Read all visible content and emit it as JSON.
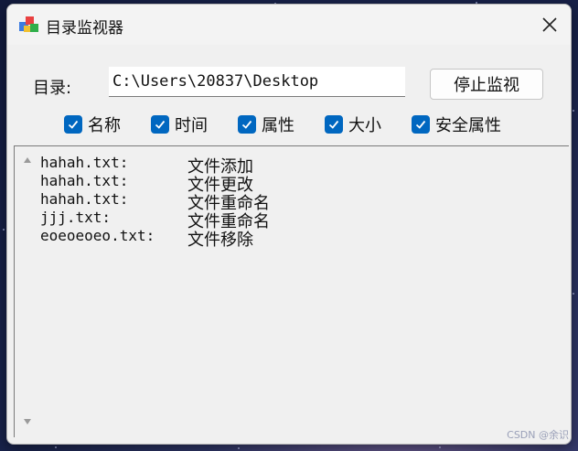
{
  "window": {
    "title": "目录监视器"
  },
  "directory": {
    "label": "目录:",
    "value": "C:\\Users\\20837\\Desktop"
  },
  "stop_button": {
    "label": "停止监视"
  },
  "checkboxes": [
    {
      "label": "名称",
      "checked": true
    },
    {
      "label": "时间",
      "checked": true
    },
    {
      "label": "属性",
      "checked": true
    },
    {
      "label": "大小",
      "checked": true
    },
    {
      "label": "安全属性",
      "checked": true
    }
  ],
  "log": [
    {
      "file": "hahah.txt:",
      "action": "文件添加"
    },
    {
      "file": "hahah.txt:",
      "action": "文件更改"
    },
    {
      "file": "hahah.txt:",
      "action": "文件重命名"
    },
    {
      "file": "jjj.txt:",
      "action": "文件重命名"
    },
    {
      "file": "eoeoeoeo.txt:",
      "action": "文件移除"
    }
  ],
  "watermark": "CSDN @余识",
  "colors": {
    "accent": "#0067c0",
    "window_bg": "#f0f0f0",
    "desktop_bg": "#18224a"
  },
  "icons": {
    "app": "app-cubes-icon",
    "close": "close-icon",
    "check": "check-icon",
    "scroll_up": "scroll-up-arrow-icon",
    "scroll_down": "scroll-down-arrow-icon"
  }
}
